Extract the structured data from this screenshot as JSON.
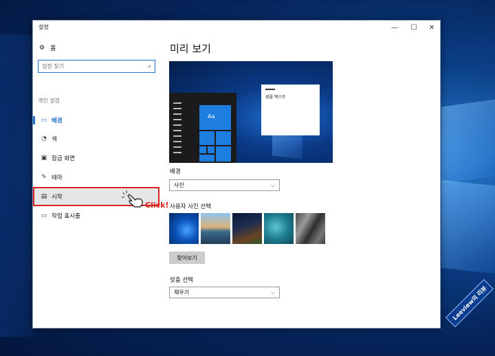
{
  "window": {
    "title": "설정",
    "controls": {
      "minimize": "—",
      "maximize": "☐",
      "close": "✕"
    }
  },
  "sidebar": {
    "home_label": "홈",
    "search_placeholder": "설정 찾기",
    "group_label": "개인 설정",
    "items": [
      {
        "label": "배경",
        "icon": "picture-icon",
        "active": true
      },
      {
        "label": "색",
        "icon": "palette-icon",
        "active": false
      },
      {
        "label": "잠금 화면",
        "icon": "lock-screen-icon",
        "active": false
      },
      {
        "label": "테마",
        "icon": "theme-icon",
        "active": false
      },
      {
        "label": "시작",
        "icon": "start-icon",
        "active": false,
        "highlighted": true
      },
      {
        "label": "작업 표시줄",
        "icon": "taskbar-icon",
        "active": false
      }
    ]
  },
  "main": {
    "title": "미리 보기",
    "preview": {
      "sample_text": "샘플 텍스트",
      "tile_label": "Aa"
    },
    "background_label": "배경",
    "background_value": "사진",
    "photo_select_label": "사용자 사진 선택",
    "browse_label": "찾아보기",
    "fit_label": "맞춤 선택",
    "fit_value": "채우기"
  },
  "annotation": {
    "click_text": "Click!",
    "watermark": "Leeview의 리뷰"
  },
  "colors": {
    "accent": "#1f6fd1",
    "highlight_border": "#d7221f"
  }
}
